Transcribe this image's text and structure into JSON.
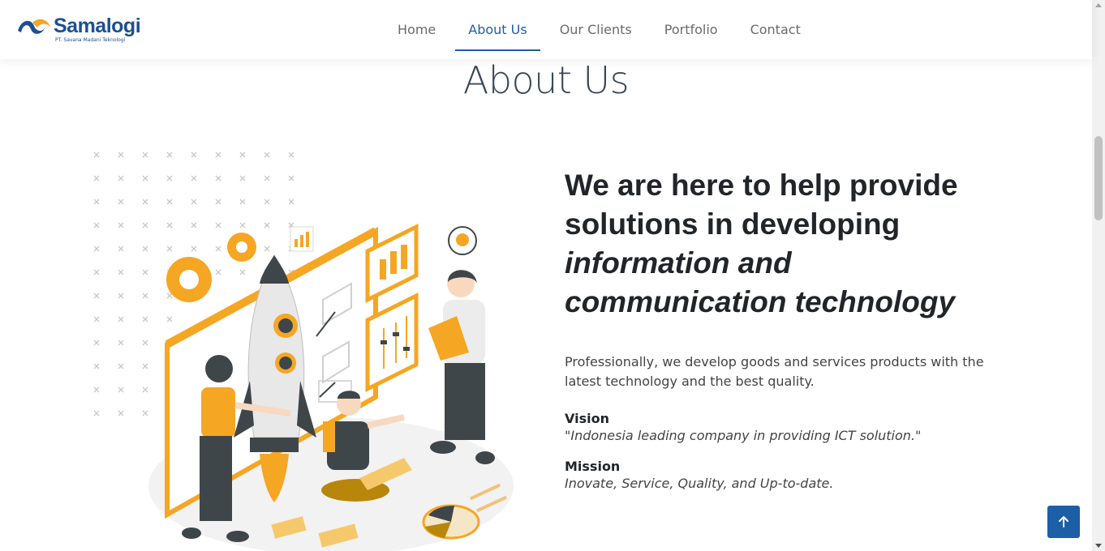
{
  "brand": {
    "name": "Samalogi",
    "tagline": "PT. Savana Madani Teknologi",
    "logo_icon": "wave-logo-icon"
  },
  "nav": {
    "items": [
      {
        "label": "Home",
        "active": false
      },
      {
        "label": "About Us",
        "active": true
      },
      {
        "label": "Our Clients",
        "active": false
      },
      {
        "label": "Portfolio",
        "active": false
      },
      {
        "label": "Contact",
        "active": false
      }
    ]
  },
  "section": {
    "title": "About Us"
  },
  "about": {
    "headline_regular": "We are here to help provide solutions in developing",
    "headline_italic": "information and communication technology",
    "description": "Professionally, we develop goods and services products with the latest technology and the best quality.",
    "vision_label": "Vision",
    "vision_text": "\"Indonesia leading company in providing ICT solution.\"",
    "mission_label": "Mission",
    "mission_text": "Inovate, Service, Quality, and Up-to-date."
  },
  "colors": {
    "brand_blue": "#1d5fa6",
    "accent_orange": "#f5a623",
    "dark_gray": "#3f4649"
  },
  "back_to_top": {
    "icon": "arrow-up-icon"
  }
}
